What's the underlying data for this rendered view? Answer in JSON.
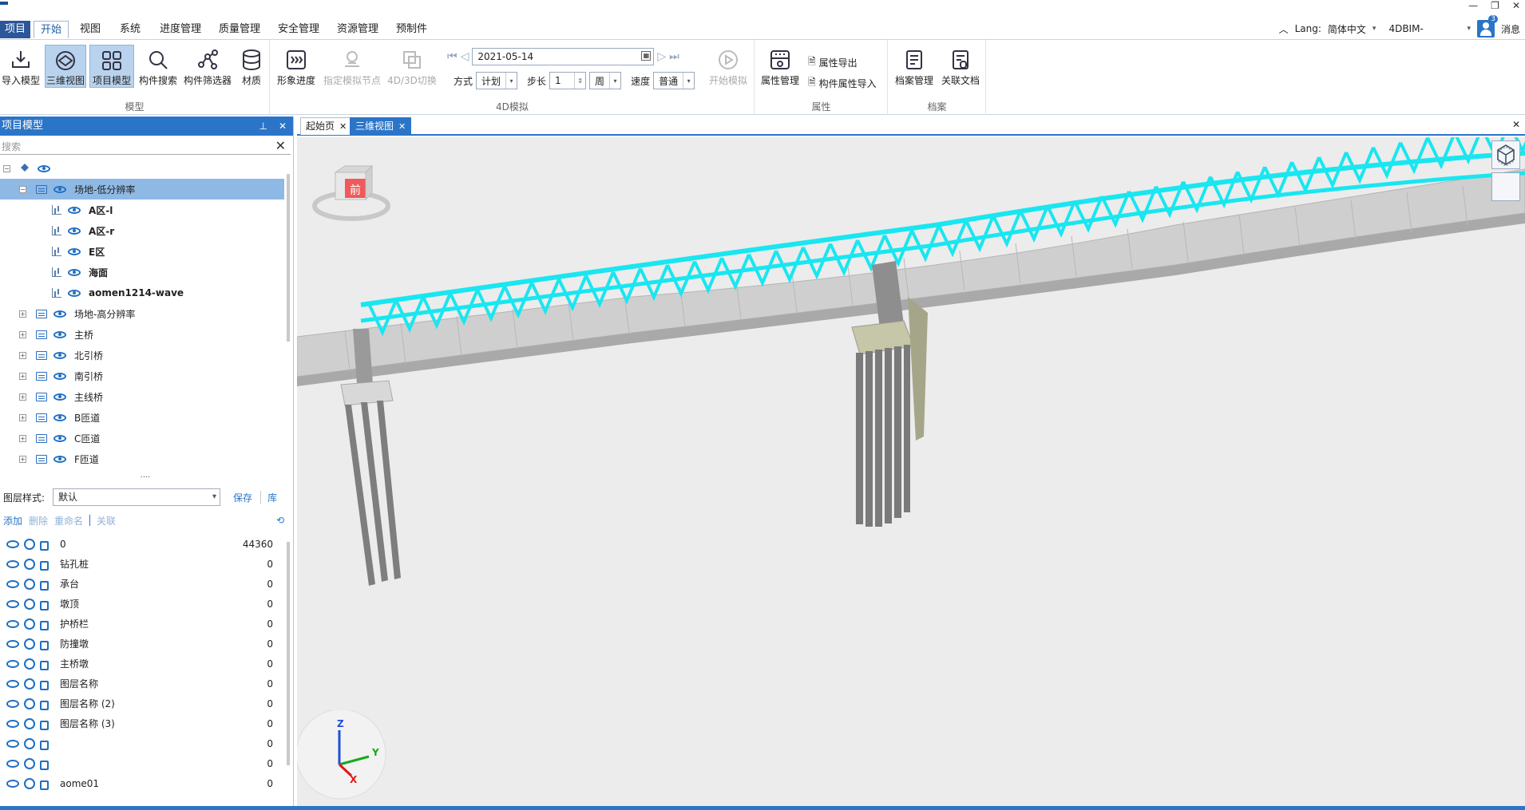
{
  "window": {
    "controls": [
      "—",
      "❐",
      "✕"
    ]
  },
  "menu": {
    "app_label": "项目",
    "items": [
      "开始",
      "视图",
      "系统",
      "进度管理",
      "质量管理",
      "安全管理",
      "资源管理",
      "预制件"
    ],
    "active": "开始"
  },
  "topright": {
    "lang_label": "Lang:",
    "lang_value": "简体中文",
    "project": "4DBIM-",
    "messages_label": "消息",
    "messages_count": "3"
  },
  "ribbon": {
    "groups": {
      "model": "模型",
      "sim4d": "4D模拟",
      "attr": "属性",
      "archive": "档案"
    },
    "buttons": {
      "import_model": "导入模型",
      "view3d": "三维视图",
      "project_model": "项目模型",
      "component_search": "构件搜索",
      "component_filter": "构件筛选器",
      "material": "材质",
      "progress": "形象进度",
      "set_node": "指定模拟节点",
      "switch_4d3d": "4D/3D切换",
      "start_sim": "开始模拟",
      "attr_manage": "属性管理",
      "attr_export": "属性导出",
      "attr_import": "构件属性导入",
      "archive_manage": "档案管理",
      "related_docs": "关联文档"
    },
    "sim": {
      "date": "2021-05-14",
      "mode_label": "方式",
      "mode_value": "计划",
      "step_label": "步长",
      "step_value": "1",
      "unit_value": "周",
      "speed_label": "速度",
      "speed_value": "普通"
    }
  },
  "left_panel": {
    "title": "项目模型",
    "search_placeholder": "搜索",
    "tree": [
      {
        "label": "",
        "level": 0,
        "expander": "−",
        "kind": "root"
      },
      {
        "label": "场地-低分辨率",
        "level": 1,
        "expander": "−",
        "kind": "folder",
        "selected": true
      },
      {
        "label": "A区-l",
        "level": 2,
        "kind": "item",
        "bold": true
      },
      {
        "label": "A区-r",
        "level": 2,
        "kind": "item",
        "bold": true
      },
      {
        "label": "E区",
        "level": 2,
        "kind": "item",
        "bold": true
      },
      {
        "label": "海面",
        "level": 2,
        "kind": "item",
        "bold": true
      },
      {
        "label": "aomen1214-wave",
        "level": 2,
        "kind": "item",
        "bold": true
      },
      {
        "label": "场地-高分辨率",
        "level": 1,
        "expander": "+",
        "kind": "folder"
      },
      {
        "label": "主桥",
        "level": 1,
        "expander": "+",
        "kind": "folder"
      },
      {
        "label": "北引桥",
        "level": 1,
        "expander": "+",
        "kind": "folder"
      },
      {
        "label": "南引桥",
        "level": 1,
        "expander": "+",
        "kind": "folder"
      },
      {
        "label": "主线桥",
        "level": 1,
        "expander": "+",
        "kind": "folder"
      },
      {
        "label": "B匝道",
        "level": 1,
        "expander": "+",
        "kind": "folder"
      },
      {
        "label": "C匝道",
        "level": 1,
        "expander": "+",
        "kind": "folder"
      },
      {
        "label": "F匝道",
        "level": 1,
        "expander": "+",
        "kind": "folder"
      }
    ],
    "layer_style_label": "图层样式:",
    "layer_style_value": "默认",
    "save": "保存",
    "library": "库",
    "actions": {
      "add": "添加",
      "delete": "删除",
      "rename": "重命名",
      "link": "关联"
    },
    "layers": [
      {
        "name": "0",
        "count": "44360"
      },
      {
        "name": "钻孔桩",
        "count": "0"
      },
      {
        "name": "承台",
        "count": "0"
      },
      {
        "name": "墩顶",
        "count": "0"
      },
      {
        "name": "护桥栏",
        "count": "0"
      },
      {
        "name": "防撞墩",
        "count": "0"
      },
      {
        "name": "主桥墩",
        "count": "0"
      },
      {
        "name": "图层名称",
        "count": "0"
      },
      {
        "name": "图层名称 (2)",
        "count": "0"
      },
      {
        "name": "图层名称 (3)",
        "count": "0"
      },
      {
        "name": "",
        "count": "0"
      },
      {
        "name": "",
        "count": "0"
      },
      {
        "name": "aome01",
        "count": "0"
      }
    ]
  },
  "doc_tabs": [
    {
      "label": "起始页",
      "active": false
    },
    {
      "label": "三维视图",
      "active": true
    }
  ],
  "viewport": {
    "viewcube_face": "前",
    "axis": {
      "x": "X",
      "y": "Y",
      "z": "Z"
    },
    "colors": {
      "truss": "#19e6f0",
      "deck": "#c8c8c8",
      "pier": "#8e8e8e",
      "background": "#ececec"
    }
  }
}
